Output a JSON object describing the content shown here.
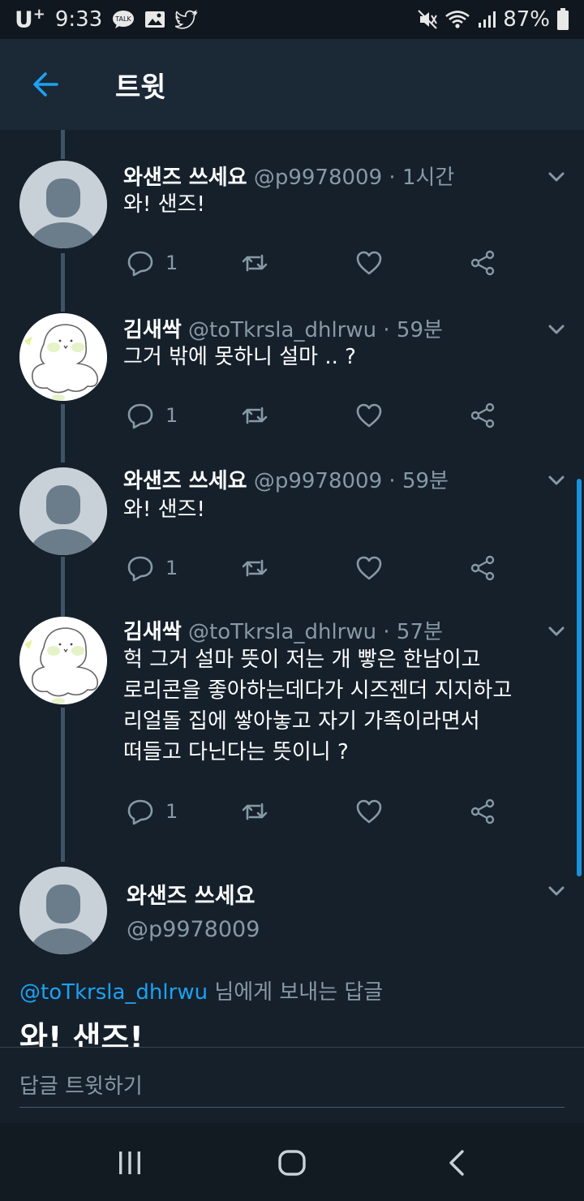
{
  "status_bar": {
    "carrier": "U",
    "carrier_sup": "+",
    "time": "9:33",
    "battery": "87%",
    "icons": [
      "talk-icon",
      "gallery-icon",
      "twitter-icon",
      "mute-icon",
      "wifi-icon",
      "signal-icon",
      "battery-icon"
    ]
  },
  "header": {
    "back_icon": "back-arrow-icon",
    "title": "트윗",
    "accent_color": "#1da1f2"
  },
  "tweets": [
    {
      "name": "와샌즈 쓰세요",
      "handle": "@p9978009",
      "dot": "·",
      "time": "1시간",
      "text": [
        "와! 샌즈!"
      ],
      "reply_count": "1",
      "avatar": "default-avatar"
    },
    {
      "name": "김새싹",
      "handle": "@toTkrsla_dhlrwu",
      "dot": "·",
      "time": "59분",
      "text": [
        "그거 밖에 못하니 설마 .. ?"
      ],
      "reply_count": "1",
      "avatar": "doodle-avatar"
    },
    {
      "name": "와샌즈 쓰세요",
      "handle": "@p9978009",
      "dot": "·",
      "time": "59분",
      "text": [
        "와! 샌즈!"
      ],
      "reply_count": "1",
      "avatar": "default-avatar"
    },
    {
      "name": "김새싹",
      "handle": "@toTkrsla_dhlrwu",
      "dot": "·",
      "time": "57분",
      "text": [
        "헉 그거 설마 뜻이 저는 개 빻은 한남이고",
        "로리콘을 좋아하는데다가 시즈젠더 지지하고",
        "리얼돌 집에 쌓아놓고 자기 가족이라면서",
        "떠들고 다닌다는 뜻이니 ?"
      ],
      "reply_count": "1",
      "avatar": "doodle-avatar"
    }
  ],
  "focus_tweet": {
    "name": "와샌즈 쓰세요",
    "handle": "@p9978009",
    "reply_to_handle": "@toTkrsla_dhlrwu",
    "reply_to_suffix": " 님에게 보내는 답글",
    "text": "와! 샌즈!"
  },
  "compose": {
    "placeholder": "답글 트윗하기"
  },
  "nav": {
    "icons": [
      "recent-apps-icon",
      "home-icon",
      "back-icon"
    ]
  }
}
